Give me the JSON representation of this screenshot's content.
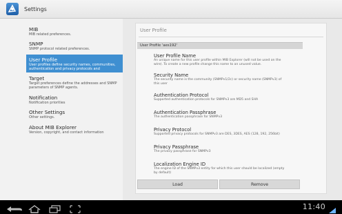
{
  "app": {
    "title": "Settings"
  },
  "sidebar": {
    "items": [
      {
        "title": "MIB",
        "summary": [
          "MIB related preferences."
        ]
      },
      {
        "title": "SNMP",
        "summary": [
          "SNMP protocol related preferences."
        ]
      },
      {
        "title": "User Profile",
        "summary": [
          "User profiles define security names, communities,",
          "authentication and privacy protocols and"
        ]
      },
      {
        "title": "Target",
        "summary": [
          "Target preferences define the addresses and SNMP",
          "parameters of SNMP agents."
        ]
      },
      {
        "title": "Notification",
        "summary": [
          "Notification priorities"
        ]
      },
      {
        "title": "Other Settings",
        "summary": [
          "Other settings."
        ]
      },
      {
        "title": "About MIB Explorer",
        "summary": [
          "Version, copyright, and contact information"
        ]
      }
    ]
  },
  "panel": {
    "title": "User Profile",
    "section_header": "User Profile 'aes192'",
    "prefs": [
      {
        "title": "User Profile Name",
        "summary": [
          "An unique name for this user profile within MIB Explorer (will not be used on the",
          "wire). To create a new profile change this name to an unused value."
        ]
      },
      {
        "title": "Security Name",
        "summary": [
          "The security name is the community (SNMPv1/2c) or security name (SNMPv3) of",
          "this user"
        ]
      },
      {
        "title": "Authentication Protocol",
        "summary": [
          "Supported authentication protocols for SNMPv3 are MD5 and SHA"
        ]
      },
      {
        "title": "Authentication Passphrase",
        "summary": [
          "The authentication passphrase for SNMPv3"
        ]
      },
      {
        "title": "Privacy Protocol",
        "summary": [
          "Supported privacy protocols for SNMPv3 are DES, 3DES, AES (128, 192, 256bit)"
        ]
      },
      {
        "title": "Privacy Passphrase",
        "summary": [
          "The privacy passphrase for SNMPv3"
        ]
      },
      {
        "title": "Localization Engine ID",
        "summary": [
          "The engine ID of the SNMPv3 entity for which this user should be localized (empty",
          "by default)"
        ]
      }
    ],
    "buttons": {
      "load": "Load",
      "remove": "Remove"
    }
  },
  "system_bar": {
    "clock": "11:40",
    "icons": [
      "back-icon",
      "home-icon",
      "recent-apps-icon",
      "screenshot-icon"
    ]
  },
  "colors": {
    "accent": "#3f8fd1",
    "panel_bg": "#f7f7f7"
  }
}
